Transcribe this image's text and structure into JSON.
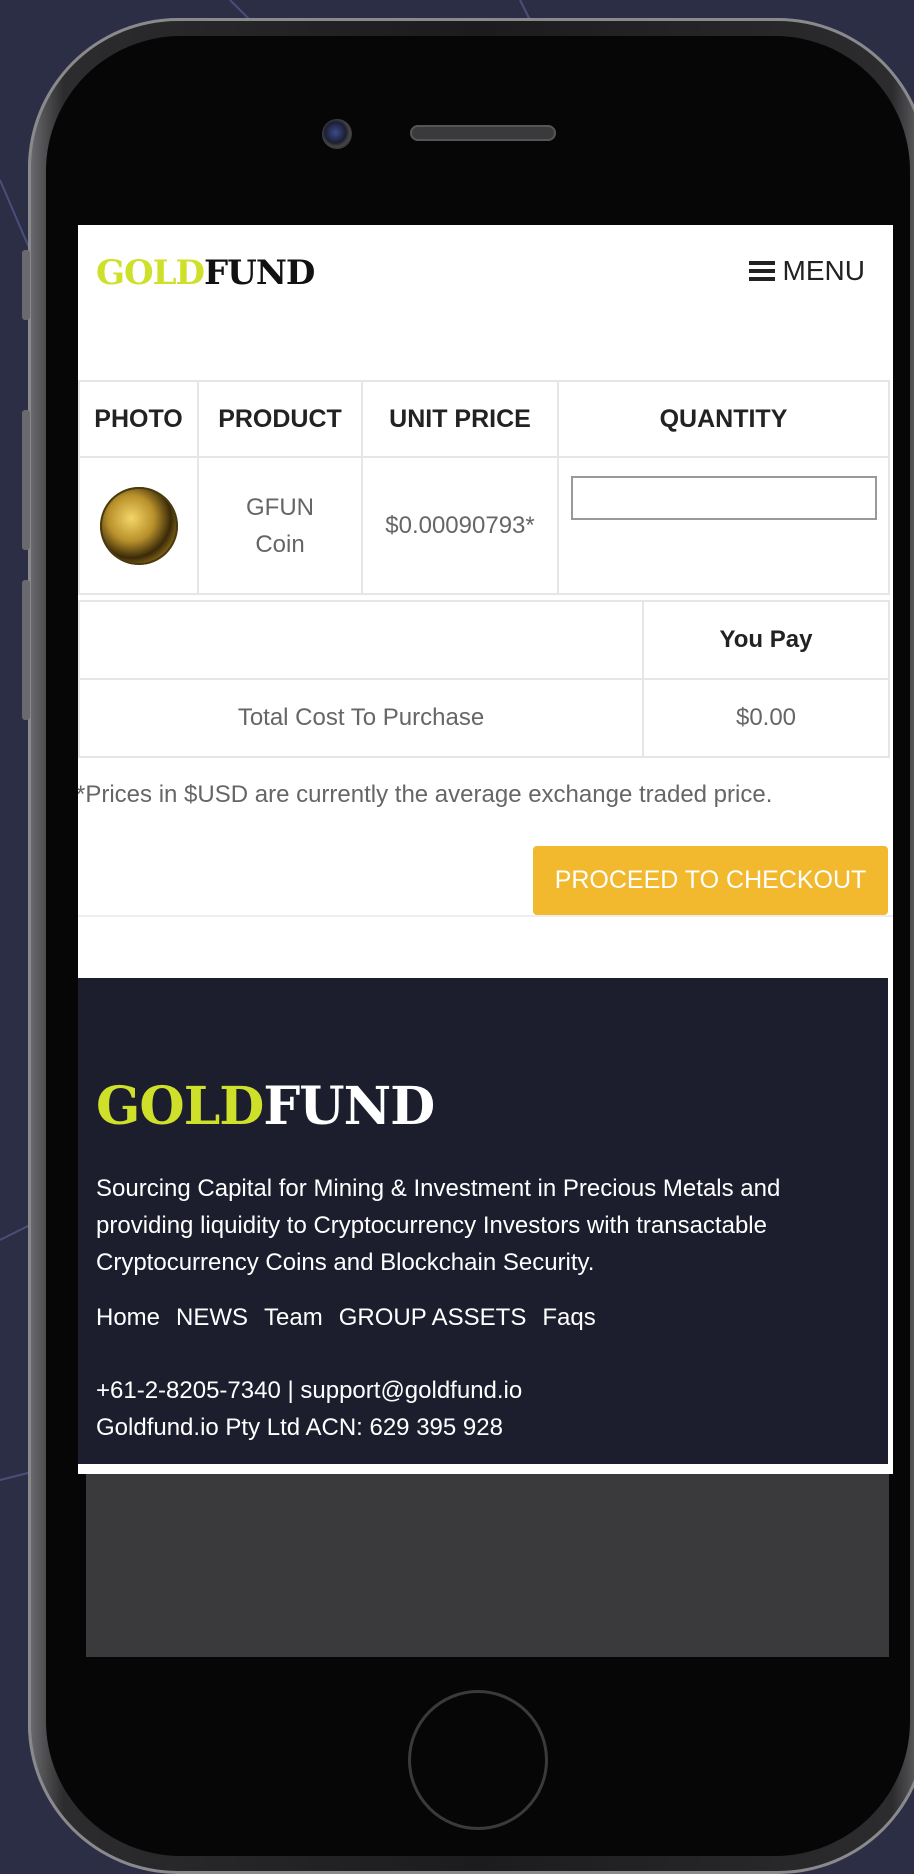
{
  "header": {
    "logo_gold": "GOLD",
    "logo_fund": "FUND",
    "menu_label": "MENU"
  },
  "cart_table": {
    "headers": [
      "PHOTO",
      "PRODUCT",
      "UNIT PRICE",
      "QUANTITY"
    ],
    "row": {
      "product_line1": "GFUN",
      "product_line2": "Coin",
      "unit_price": "$0.00090793*",
      "quantity_value": ""
    }
  },
  "totals_table": {
    "header": "You Pay",
    "label": "Total Cost To Purchase",
    "value": "$0.00"
  },
  "footnote": "*Prices in $USD are currently the average exchange traded price.",
  "checkout_label": "PROCEED TO CHECKOUT",
  "footer": {
    "logo_gold": "GOLD",
    "logo_fund": "FUND",
    "description": "Sourcing Capital for Mining & Investment in Precious Metals and providing liquidity to Cryptocurrency Investors with transactable Cryptocurrency Coins and Blockchain Security.",
    "nav": [
      "Home",
      "NEWS",
      "Team",
      "GROUP ASSETS",
      "Faqs"
    ],
    "contact_line1": "+61-2-8205-7340 | support@goldfund.io",
    "contact_line2": "Goldfund.io Pty Ltd ACN: 629 395 928"
  },
  "colors": {
    "background": "#2b2e45",
    "logo_gold": "#cfe02a",
    "checkout_button": "#f2b82e",
    "footer_bg": "#1c1e2e"
  }
}
